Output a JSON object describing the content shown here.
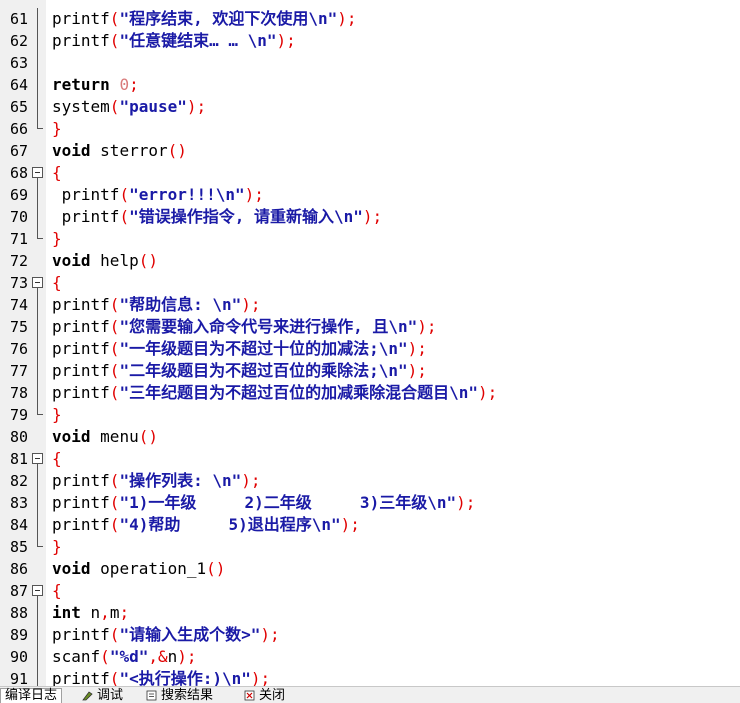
{
  "code_lines": [
    {
      "n": "61",
      "fold": "vline",
      "tokens": [
        {
          "t": "printf",
          "c": "id"
        },
        {
          "t": "(",
          "c": "br"
        },
        {
          "t": "\"程序结束, 欢迎下次使用\\n\"",
          "c": "str"
        },
        {
          "t": ");",
          "c": "br"
        }
      ]
    },
    {
      "n": "62",
      "fold": "vline",
      "tokens": [
        {
          "t": "printf",
          "c": "id"
        },
        {
          "t": "(",
          "c": "br"
        },
        {
          "t": "\"任意键结束… … \\n\"",
          "c": "str"
        },
        {
          "t": ");",
          "c": "br"
        }
      ]
    },
    {
      "n": "63",
      "fold": "vline",
      "tokens": []
    },
    {
      "n": "64",
      "fold": "vline",
      "tokens": [
        {
          "t": "return ",
          "c": "kw"
        },
        {
          "t": "0",
          "c": "num"
        },
        {
          "t": ";",
          "c": "br"
        }
      ]
    },
    {
      "n": "65",
      "fold": "vline",
      "tokens": [
        {
          "t": "system",
          "c": "id"
        },
        {
          "t": "(",
          "c": "br"
        },
        {
          "t": "\"pause\"",
          "c": "str"
        },
        {
          "t": ");",
          "c": "br"
        }
      ]
    },
    {
      "n": "66",
      "fold": "end",
      "tokens": [
        {
          "t": "}",
          "c": "br"
        }
      ]
    },
    {
      "n": "67",
      "fold": "",
      "tokens": [
        {
          "t": "void ",
          "c": "kw"
        },
        {
          "t": "sterror",
          "c": "id"
        },
        {
          "t": "()",
          "c": "br"
        }
      ]
    },
    {
      "n": "68",
      "fold": "box",
      "tokens": [
        {
          "t": "{",
          "c": "br"
        }
      ]
    },
    {
      "n": "69",
      "fold": "vline",
      "tokens": [
        {
          "t": " printf",
          "c": "id"
        },
        {
          "t": "(",
          "c": "br"
        },
        {
          "t": "\"error!!!\\n\"",
          "c": "str"
        },
        {
          "t": ");",
          "c": "br"
        }
      ]
    },
    {
      "n": "70",
      "fold": "vline",
      "tokens": [
        {
          "t": " printf",
          "c": "id"
        },
        {
          "t": "(",
          "c": "br"
        },
        {
          "t": "\"错误操作指令, 请重新输入\\n\"",
          "c": "str"
        },
        {
          "t": ");",
          "c": "br"
        }
      ]
    },
    {
      "n": "71",
      "fold": "end",
      "tokens": [
        {
          "t": "}",
          "c": "br"
        }
      ]
    },
    {
      "n": "72",
      "fold": "",
      "tokens": [
        {
          "t": "void ",
          "c": "kw"
        },
        {
          "t": "help",
          "c": "id"
        },
        {
          "t": "()",
          "c": "br"
        }
      ]
    },
    {
      "n": "73",
      "fold": "box",
      "tokens": [
        {
          "t": "{",
          "c": "br"
        }
      ]
    },
    {
      "n": "74",
      "fold": "vline",
      "tokens": [
        {
          "t": "printf",
          "c": "id"
        },
        {
          "t": "(",
          "c": "br"
        },
        {
          "t": "\"帮助信息: \\n\"",
          "c": "str"
        },
        {
          "t": ");",
          "c": "br"
        }
      ]
    },
    {
      "n": "75",
      "fold": "vline",
      "tokens": [
        {
          "t": "printf",
          "c": "id"
        },
        {
          "t": "(",
          "c": "br"
        },
        {
          "t": "\"您需要输入命令代号来进行操作, 且\\n\"",
          "c": "str"
        },
        {
          "t": ");",
          "c": "br"
        }
      ]
    },
    {
      "n": "76",
      "fold": "vline",
      "tokens": [
        {
          "t": "printf",
          "c": "id"
        },
        {
          "t": "(",
          "c": "br"
        },
        {
          "t": "\"一年级题目为不超过十位的加减法;\\n\"",
          "c": "str"
        },
        {
          "t": ");",
          "c": "br"
        }
      ]
    },
    {
      "n": "77",
      "fold": "vline",
      "tokens": [
        {
          "t": "printf",
          "c": "id"
        },
        {
          "t": "(",
          "c": "br"
        },
        {
          "t": "\"二年级题目为不超过百位的乘除法;\\n\"",
          "c": "str"
        },
        {
          "t": ");",
          "c": "br"
        }
      ]
    },
    {
      "n": "78",
      "fold": "vline",
      "tokens": [
        {
          "t": "printf",
          "c": "id"
        },
        {
          "t": "(",
          "c": "br"
        },
        {
          "t": "\"三年纪题目为不超过百位的加减乘除混合题目\\n\"",
          "c": "str"
        },
        {
          "t": ");",
          "c": "br"
        }
      ]
    },
    {
      "n": "79",
      "fold": "end",
      "tokens": [
        {
          "t": "}",
          "c": "br"
        }
      ]
    },
    {
      "n": "80",
      "fold": "",
      "tokens": [
        {
          "t": "void ",
          "c": "kw"
        },
        {
          "t": "menu",
          "c": "id"
        },
        {
          "t": "()",
          "c": "br"
        }
      ]
    },
    {
      "n": "81",
      "fold": "box",
      "tokens": [
        {
          "t": "{",
          "c": "br"
        }
      ]
    },
    {
      "n": "82",
      "fold": "vline",
      "tokens": [
        {
          "t": "printf",
          "c": "id"
        },
        {
          "t": "(",
          "c": "br"
        },
        {
          "t": "\"操作列表: \\n\"",
          "c": "str"
        },
        {
          "t": ");",
          "c": "br"
        }
      ]
    },
    {
      "n": "83",
      "fold": "vline",
      "tokens": [
        {
          "t": "printf",
          "c": "id"
        },
        {
          "t": "(",
          "c": "br"
        },
        {
          "t": "\"1)一年级     2)二年级     3)三年级\\n\"",
          "c": "str"
        },
        {
          "t": ");",
          "c": "br"
        }
      ]
    },
    {
      "n": "84",
      "fold": "vline",
      "tokens": [
        {
          "t": "printf",
          "c": "id"
        },
        {
          "t": "(",
          "c": "br"
        },
        {
          "t": "\"4)帮助     5)退出程序\\n\"",
          "c": "str"
        },
        {
          "t": ");",
          "c": "br"
        }
      ]
    },
    {
      "n": "85",
      "fold": "end",
      "tokens": [
        {
          "t": "}",
          "c": "br"
        }
      ]
    },
    {
      "n": "86",
      "fold": "",
      "tokens": [
        {
          "t": "void ",
          "c": "kw"
        },
        {
          "t": "operation_1",
          "c": "id"
        },
        {
          "t": "()",
          "c": "br"
        }
      ]
    },
    {
      "n": "87",
      "fold": "box",
      "tokens": [
        {
          "t": "{",
          "c": "br"
        }
      ]
    },
    {
      "n": "88",
      "fold": "vline",
      "tokens": [
        {
          "t": "int ",
          "c": "kw"
        },
        {
          "t": "n",
          "c": "id"
        },
        {
          "t": ",",
          "c": "br"
        },
        {
          "t": "m",
          "c": "id"
        },
        {
          "t": ";",
          "c": "br"
        }
      ]
    },
    {
      "n": "89",
      "fold": "vline",
      "tokens": [
        {
          "t": "printf",
          "c": "id"
        },
        {
          "t": "(",
          "c": "br"
        },
        {
          "t": "\"请输入生成个数>\"",
          "c": "str"
        },
        {
          "t": ");",
          "c": "br"
        }
      ]
    },
    {
      "n": "90",
      "fold": "vline",
      "tokens": [
        {
          "t": "scanf",
          "c": "id"
        },
        {
          "t": "(",
          "c": "br"
        },
        {
          "t": "\"%d\"",
          "c": "str"
        },
        {
          "t": ",&",
          "c": "br"
        },
        {
          "t": "n",
          "c": "id"
        },
        {
          "t": ");",
          "c": "br"
        }
      ]
    },
    {
      "n": "91",
      "fold": "vline",
      "tokens": [
        {
          "t": "printf",
          "c": "id"
        },
        {
          "t": "(",
          "c": "br"
        },
        {
          "t": "\"<执行操作:)\\n\"",
          "c": "str"
        },
        {
          "t": ");",
          "c": "br"
        }
      ]
    }
  ],
  "bottom_tabs": [
    {
      "label": "编译日志",
      "icon": "compile-log-icon",
      "active": true
    },
    {
      "label": "调试",
      "icon": "debug-icon",
      "active": false
    },
    {
      "label": "搜索结果",
      "icon": "search-results-icon",
      "active": false
    },
    {
      "label": "关闭",
      "icon": "close-icon",
      "active": false
    }
  ]
}
